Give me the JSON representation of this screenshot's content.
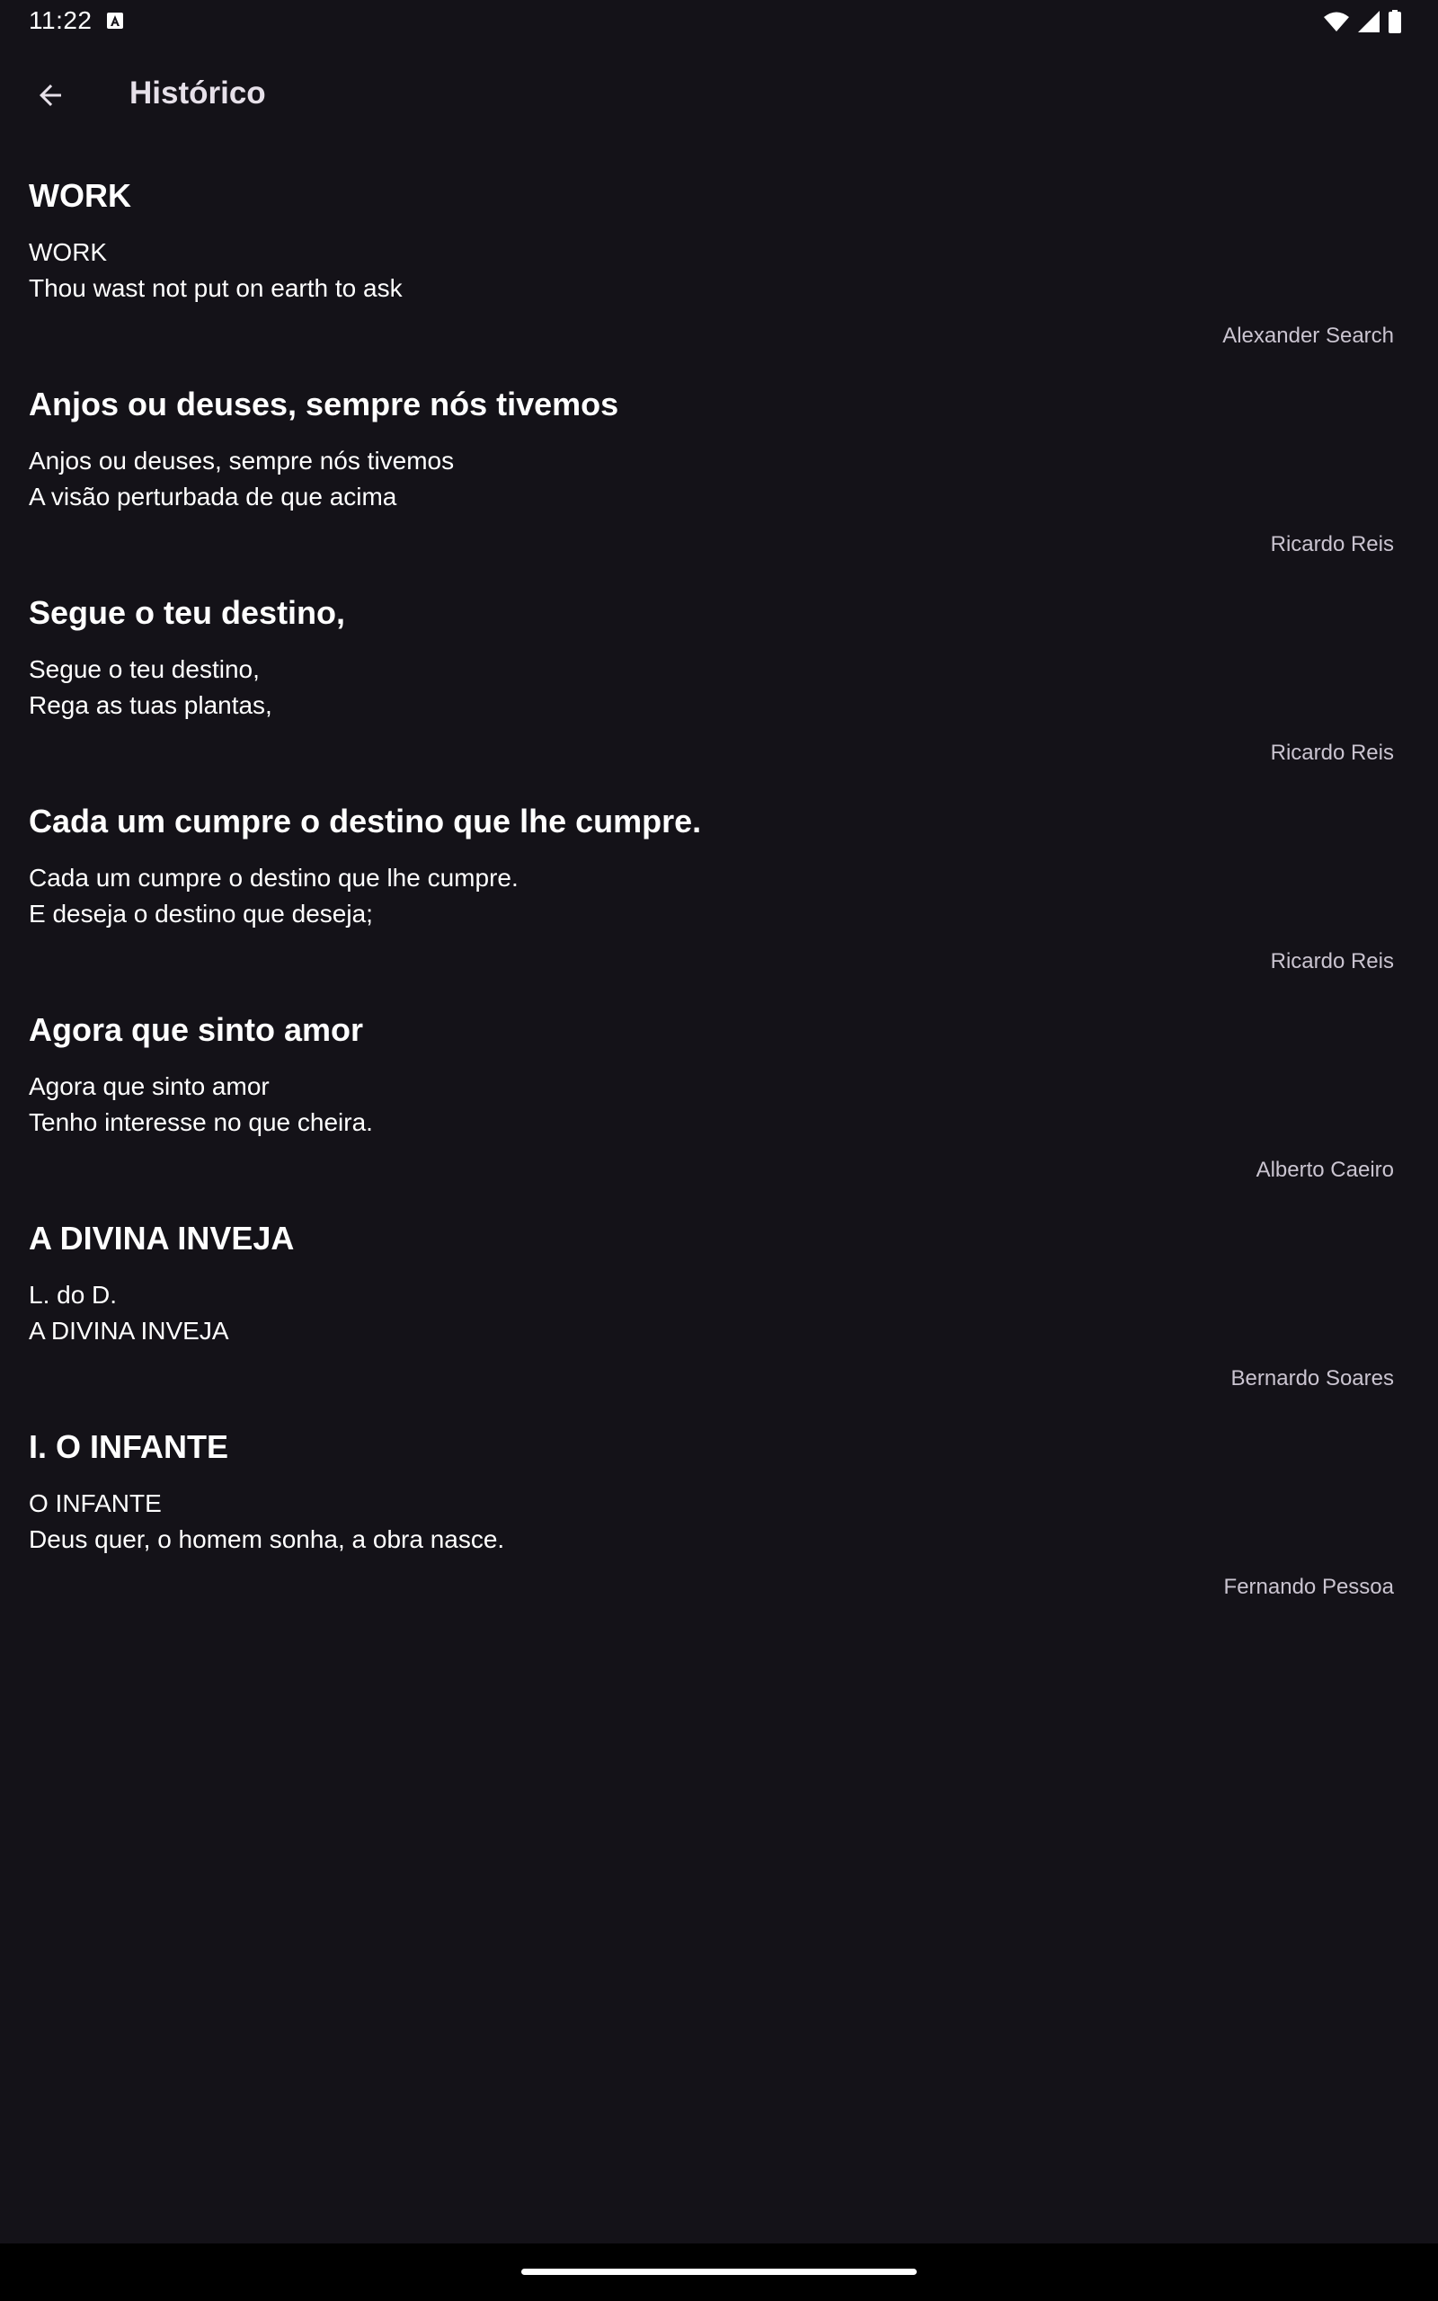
{
  "status_bar": {
    "time": "11:22",
    "icons": [
      "font-notification-icon",
      "wifi-icon",
      "cell-signal-icon",
      "battery-icon"
    ]
  },
  "app_bar": {
    "title": "Histórico",
    "back_icon": "arrow-back-icon"
  },
  "history": [
    {
      "title": "WORK",
      "line1": "WORK",
      "line2": "Thou wast not put on earth to ask",
      "author": "Alexander Search"
    },
    {
      "title": "Anjos ou deuses, sempre nós tivemos",
      "line1": "Anjos ou deuses, sempre nós tivemos",
      "line2": "A visão perturbada de que acima",
      "author": "Ricardo Reis"
    },
    {
      "title": "Segue o teu destino,",
      "line1": "Segue o teu destino,",
      "line2": "Rega as tuas plantas,",
      "author": "Ricardo Reis"
    },
    {
      "title": "Cada um cumpre o destino que lhe cumpre.",
      "line1": "Cada um cumpre o destino que lhe cumpre.",
      "line2": "E deseja o destino que deseja;",
      "author": "Ricardo Reis"
    },
    {
      "title": "Agora que sinto amor",
      "line1": "Agora que sinto amor",
      "line2": "Tenho interesse no que cheira.",
      "author": "Alberto Caeiro"
    },
    {
      "title": "A DIVINA INVEJA",
      "line1": "L. do D.",
      "line2": "A DIVINA INVEJA",
      "author": "Bernardo Soares"
    },
    {
      "title": "I. O INFANTE",
      "line1": "O INFANTE",
      "line2": "Deus quer, o homem sonha, a obra nasce.",
      "author": "Fernando Pessoa"
    }
  ],
  "colors": {
    "background": "#141218",
    "on_surface": "#e6e0e9",
    "secondary_text": "#cac4d0",
    "nav_bar": "#000000"
  }
}
